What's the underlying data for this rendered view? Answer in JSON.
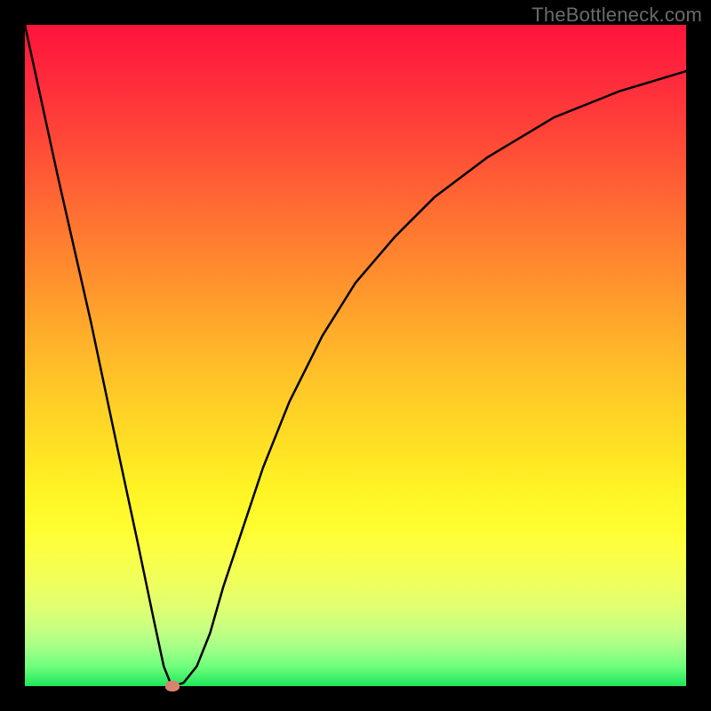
{
  "watermark": "TheBottleneck.com",
  "chart_data": {
    "type": "line",
    "title": "",
    "xlabel": "",
    "ylabel": "",
    "xlim": [
      0,
      100
    ],
    "ylim": [
      0,
      100
    ],
    "x": [
      0,
      5,
      10,
      14,
      17,
      19.5,
      21,
      22,
      23,
      24,
      26,
      28,
      30,
      33,
      36,
      40,
      45,
      50,
      56,
      62,
      70,
      80,
      90,
      100
    ],
    "values": [
      100,
      77,
      55,
      36,
      22,
      10,
      3,
      0.5,
      0.2,
      0.5,
      3,
      8,
      15,
      24,
      33,
      43,
      53,
      61,
      68,
      74,
      80,
      86,
      90,
      93
    ],
    "marker": {
      "x": 22.3,
      "y": 0
    },
    "gradient_stops": [
      {
        "pos": 0,
        "color": "#ff143c"
      },
      {
        "pos": 50,
        "color": "#ffcc27"
      },
      {
        "pos": 80,
        "color": "#fbff45"
      },
      {
        "pos": 100,
        "color": "#1fe65c"
      }
    ]
  }
}
